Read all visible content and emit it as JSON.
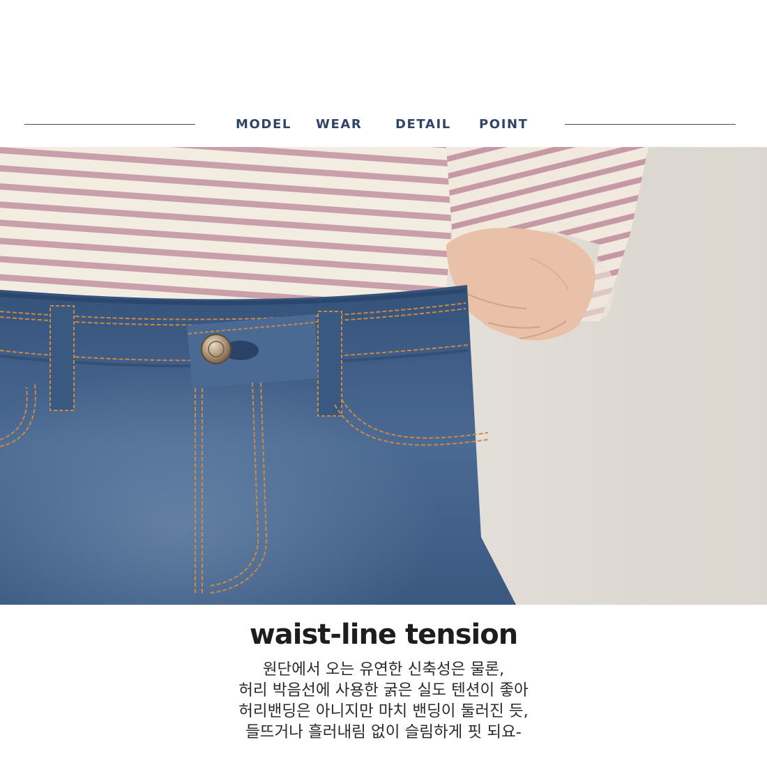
{
  "nav": {
    "items": [
      {
        "id": "model",
        "label": "MODEL"
      },
      {
        "id": "wear",
        "label": "WEAR"
      },
      {
        "id": "detail",
        "label": "DETAIL"
      },
      {
        "id": "point",
        "label": "POINT"
      }
    ]
  },
  "photo": {
    "subject": "striped-top-and-denim-waistband"
  },
  "headline": "waist-line tension",
  "description": {
    "lines": [
      "원단에서 오는 유연한 신축성은 물론,",
      "허리 박음선에 사용한 굵은 실도 텐션이 좋아",
      "허리밴딩은 아니지만 마치 밴딩이 둘러진 듯,",
      "들뜨거나 흘러내림 없이 슬림하게 핏 되요-"
    ]
  },
  "colors": {
    "nav_text": "#2f4466",
    "rule": "#3f4b5e",
    "stripe_pink": "#c9a0aa",
    "stripe_cream": "#f3ece1",
    "denim": "#3d5a82",
    "stitch": "#c98a45"
  }
}
